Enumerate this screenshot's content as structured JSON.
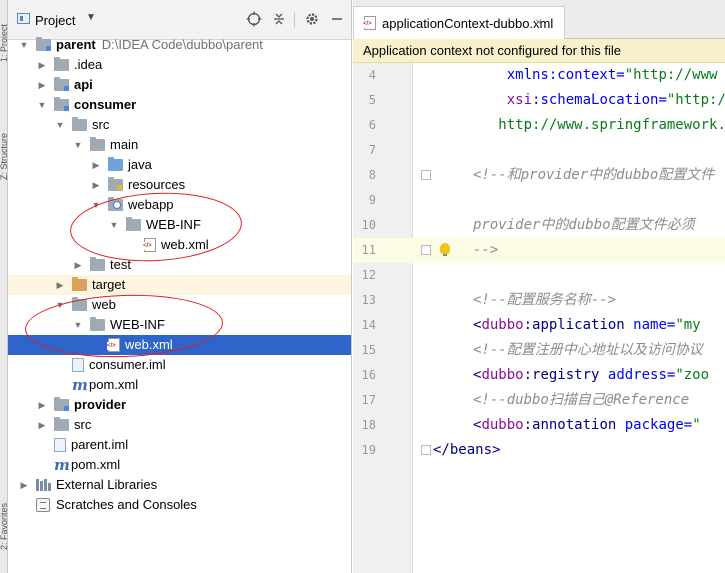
{
  "side_strip": {
    "top_label": "1: Project",
    "mid_label": "Z: Structure",
    "bottom_label": "2: Favorites"
  },
  "project_panel": {
    "title": "Project",
    "title_icon": "project-view-icon",
    "toolbar_icons": [
      "locate-target-icon",
      "collapse-all-icon",
      "gear-icon",
      "hide-panel-icon"
    ]
  },
  "tree": [
    {
      "label": "parent",
      "path": "D:\\IDEA Code\\dubbo\\parent",
      "bold": true,
      "depth": 0,
      "arrow": "down",
      "icon": "module-folder-icon"
    },
    {
      "label": ".idea",
      "depth": 1,
      "arrow": "right",
      "icon": "folder-icon"
    },
    {
      "label": "api",
      "bold": true,
      "depth": 1,
      "arrow": "right",
      "icon": "module-folder-icon"
    },
    {
      "label": "consumer",
      "bold": true,
      "depth": 1,
      "arrow": "down",
      "icon": "module-folder-icon"
    },
    {
      "label": "src",
      "depth": 2,
      "arrow": "down",
      "icon": "folder-icon"
    },
    {
      "label": "main",
      "depth": 3,
      "arrow": "down",
      "icon": "folder-icon"
    },
    {
      "label": "java",
      "depth": 4,
      "arrow": "right",
      "icon": "source-folder-icon"
    },
    {
      "label": "resources",
      "depth": 4,
      "arrow": "right",
      "icon": "resources-folder-icon"
    },
    {
      "label": "webapp",
      "depth": 4,
      "arrow": "down",
      "icon": "web-folder-icon"
    },
    {
      "label": "WEB-INF",
      "depth": 5,
      "arrow": "down",
      "icon": "folder-icon"
    },
    {
      "label": "web.xml",
      "depth": 6,
      "icon": "xml-file-icon"
    },
    {
      "label": "test",
      "depth": 3,
      "arrow": "right",
      "icon": "folder-icon"
    },
    {
      "label": "target",
      "depth": 2,
      "arrow": "right",
      "icon": "excluded-folder-icon",
      "ignored": true
    },
    {
      "label": "web",
      "depth": 2,
      "arrow": "down",
      "icon": "folder-icon"
    },
    {
      "label": "WEB-INF",
      "depth": 3,
      "arrow": "down",
      "icon": "folder-icon"
    },
    {
      "label": "web.xml",
      "depth": 4,
      "icon": "xml-file-icon",
      "selected": true
    },
    {
      "label": "consumer.iml",
      "depth": 2,
      "icon": "iml-file-icon"
    },
    {
      "label": "pom.xml",
      "depth": 2,
      "icon": "maven-pom-icon"
    },
    {
      "label": "provider",
      "bold": true,
      "depth": 1,
      "arrow": "right",
      "icon": "module-folder-icon"
    },
    {
      "label": "src",
      "depth": 1,
      "arrow": "right",
      "icon": "folder-icon"
    },
    {
      "label": "parent.iml",
      "depth": 1,
      "icon": "iml-file-icon"
    },
    {
      "label": "pom.xml",
      "depth": 1,
      "icon": "maven-pom-icon"
    },
    {
      "label": "External Libraries",
      "depth": 0,
      "arrow": "right",
      "icon": "libraries-icon"
    },
    {
      "label": "Scratches and Consoles",
      "depth": 0,
      "icon": "scratches-icon"
    }
  ],
  "editor": {
    "tab_name": "applicationContext-dubbo.xml",
    "tab_close": "×",
    "banner": "Application context not configured for this file",
    "lines": [
      {
        "num": "4",
        "segments": [
          {
            "t": "    ",
            "c": "plain"
          },
          {
            "t": "xmlns:context=",
            "c": "attr"
          },
          {
            "t": "\"http://www",
            "c": "str"
          }
        ]
      },
      {
        "num": "5",
        "segments": [
          {
            "t": "    ",
            "c": "plain"
          },
          {
            "t": "xsi",
            "c": "ns"
          },
          {
            "t": ":schemaLocation=",
            "c": "attr"
          },
          {
            "t": "\"http://",
            "c": "str"
          }
        ]
      },
      {
        "num": "6",
        "segments": [
          {
            "t": "   ",
            "c": "plain"
          },
          {
            "t": "http://www.springframework.o",
            "c": "str"
          }
        ]
      },
      {
        "num": "7",
        "segments": []
      },
      {
        "num": "8",
        "segments": [
          {
            "t": "<!--和provider中的dubbo配置文件",
            "c": "cm"
          }
        ]
      },
      {
        "num": "9",
        "segments": []
      },
      {
        "num": "10",
        "segments": [
          {
            "t": "provider中的dubbo配置文件必须",
            "c": "cm"
          }
        ]
      },
      {
        "num": "11",
        "segments": [
          {
            "t": "-->",
            "c": "cm"
          }
        ],
        "highlight": true
      },
      {
        "num": "12",
        "segments": []
      },
      {
        "num": "13",
        "segments": [
          {
            "t": "<!--配置服务名称-->",
            "c": "cm"
          }
        ]
      },
      {
        "num": "14",
        "segments": [
          {
            "t": "<",
            "c": "tag"
          },
          {
            "t": "dubbo",
            "c": "ns"
          },
          {
            "t": ":application ",
            "c": "tag"
          },
          {
            "t": "name=",
            "c": "attr"
          },
          {
            "t": "\"my",
            "c": "str"
          }
        ]
      },
      {
        "num": "15",
        "segments": [
          {
            "t": "<!--配置注册中心地址以及访问协议",
            "c": "cm"
          }
        ]
      },
      {
        "num": "16",
        "segments": [
          {
            "t": "<",
            "c": "tag"
          },
          {
            "t": "dubbo",
            "c": "ns"
          },
          {
            "t": ":registry ",
            "c": "tag"
          },
          {
            "t": "address=",
            "c": "attr"
          },
          {
            "t": "\"zoo",
            "c": "str"
          }
        ]
      },
      {
        "num": "17",
        "segments": [
          {
            "t": "<!--dubbo扫描自己@Reference",
            "c": "cm"
          }
        ]
      },
      {
        "num": "18",
        "segments": [
          {
            "t": "<",
            "c": "tag"
          },
          {
            "t": "dubbo",
            "c": "ns"
          },
          {
            "t": ":annotation ",
            "c": "tag"
          },
          {
            "t": "package=",
            "c": "attr"
          },
          {
            "t": "\"",
            "c": "str"
          }
        ]
      },
      {
        "num": "19",
        "segments": [
          {
            "t": "</",
            "c": "tag"
          },
          {
            "t": "beans",
            "c": "tag"
          },
          {
            "t": ">",
            "c": "tag"
          }
        ],
        "outdent": true
      }
    ]
  },
  "colors": {
    "selection": "#2f65ca",
    "banner_bg": "#f9f1cc",
    "annotation_circle": "#e41b1b"
  }
}
